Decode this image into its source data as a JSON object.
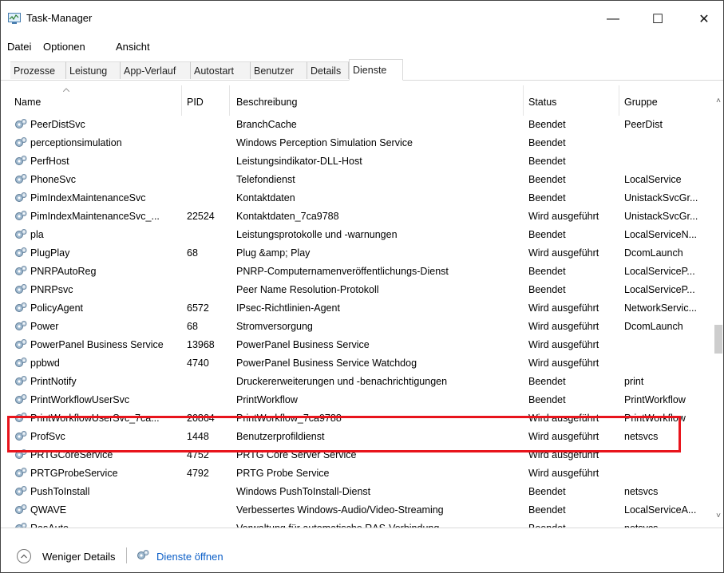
{
  "window": {
    "title": "Task-Manager",
    "minimize": "—",
    "maximize": "☐",
    "close": "✕"
  },
  "menu": [
    "Datei",
    "Optionen",
    "Ansicht"
  ],
  "tabs": [
    "Prozesse",
    "Leistung",
    "App-Verlauf",
    "Autostart",
    "Benutzer",
    "Details",
    "Dienste"
  ],
  "active_tab": "Dienste",
  "columns": {
    "name": "Name",
    "pid": "PID",
    "description": "Beschreibung",
    "status": "Status",
    "group": "Gruppe"
  },
  "rows": [
    {
      "name": "PeerDistSvc",
      "pid": "",
      "description": "BranchCache",
      "status": "Beendet",
      "group": "PeerDist"
    },
    {
      "name": "perceptionsimulation",
      "pid": "",
      "description": "Windows Perception Simulation Service",
      "status": "Beendet",
      "group": ""
    },
    {
      "name": "PerfHost",
      "pid": "",
      "description": "Leistungsindikator-DLL-Host",
      "status": "Beendet",
      "group": ""
    },
    {
      "name": "PhoneSvc",
      "pid": "",
      "description": "Telefondienst",
      "status": "Beendet",
      "group": "LocalService"
    },
    {
      "name": "PimIndexMaintenanceSvc",
      "pid": "",
      "description": "Kontaktdaten",
      "status": "Beendet",
      "group": "UnistackSvcGr..."
    },
    {
      "name": "PimIndexMaintenanceSvc_...",
      "pid": "22524",
      "description": "Kontaktdaten_7ca9788",
      "status": "Wird ausgeführt",
      "group": "UnistackSvcGr..."
    },
    {
      "name": "pla",
      "pid": "",
      "description": "Leistungsprotokolle und -warnungen",
      "status": "Beendet",
      "group": "LocalServiceN..."
    },
    {
      "name": "PlugPlay",
      "pid": "68",
      "description": "Plug &amp; Play",
      "status": "Wird ausgeführt",
      "group": "DcomLaunch"
    },
    {
      "name": "PNRPAutoReg",
      "pid": "",
      "description": "PNRP-Computernamenveröffentlichungs-Dienst",
      "status": "Beendet",
      "group": "LocalServiceP..."
    },
    {
      "name": "PNRPsvc",
      "pid": "",
      "description": "Peer Name Resolution-Protokoll",
      "status": "Beendet",
      "group": "LocalServiceP..."
    },
    {
      "name": "PolicyAgent",
      "pid": "6572",
      "description": "IPsec-Richtlinien-Agent",
      "status": "Wird ausgeführt",
      "group": "NetworkServic..."
    },
    {
      "name": "Power",
      "pid": "68",
      "description": "Stromversorgung",
      "status": "Wird ausgeführt",
      "group": "DcomLaunch"
    },
    {
      "name": "PowerPanel Business Service",
      "pid": "13968",
      "description": "PowerPanel Business Service",
      "status": "Wird ausgeführt",
      "group": ""
    },
    {
      "name": "ppbwd",
      "pid": "4740",
      "description": "PowerPanel Business Service Watchdog",
      "status": "Wird ausgeführt",
      "group": ""
    },
    {
      "name": "PrintNotify",
      "pid": "",
      "description": "Druckererweiterungen und -benachrichtigungen",
      "status": "Beendet",
      "group": "print"
    },
    {
      "name": "PrintWorkflowUserSvc",
      "pid": "",
      "description": "PrintWorkflow",
      "status": "Beendet",
      "group": "PrintWorkflow"
    },
    {
      "name": "PrintWorkflowUserSvc_7ca...",
      "pid": "20864",
      "description": "PrintWorkflow_7ca9788",
      "status": "Wird ausgeführt",
      "group": "PrintWorkflow"
    },
    {
      "name": "ProfSvc",
      "pid": "1448",
      "description": "Benutzerprofildienst",
      "status": "Wird ausgeführt",
      "group": "netsvcs"
    },
    {
      "name": "PRTGCoreService",
      "pid": "4752",
      "description": "PRTG Core Server Service",
      "status": "Wird ausgeführt",
      "group": ""
    },
    {
      "name": "PRTGProbeService",
      "pid": "4792",
      "description": "PRTG Probe Service",
      "status": "Wird ausgeführt",
      "group": ""
    },
    {
      "name": "PushToInstall",
      "pid": "",
      "description": "Windows PushToInstall-Dienst",
      "status": "Beendet",
      "group": "netsvcs"
    },
    {
      "name": "QWAVE",
      "pid": "",
      "description": "Verbessertes Windows-Audio/Video-Streaming",
      "status": "Beendet",
      "group": "LocalServiceA..."
    },
    {
      "name": "RasAuto",
      "pid": "",
      "description": "Verwaltung für automatische RAS-Verbindung",
      "status": "Beendet",
      "group": "netsvcs"
    }
  ],
  "footer": {
    "fewer_details": "Weniger Details",
    "open_services": "Dienste öffnen"
  },
  "colors": {
    "highlight": "#e8141c",
    "link": "#0b5ec7"
  }
}
